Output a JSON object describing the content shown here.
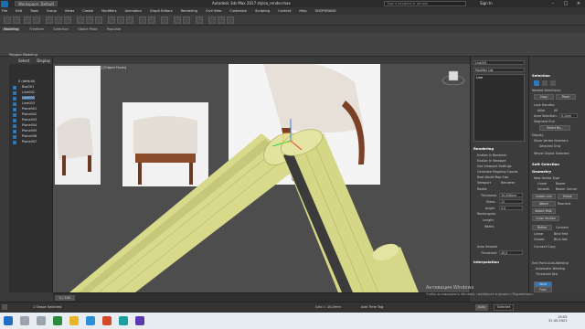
{
  "title_bar": {
    "workspace": "Workspace: Default",
    "app_title": "Autodesk 3ds Max 2017    stylsa_render.max",
    "search_placeholder": "Type a keyword or phrase",
    "sign_in": "Sign In"
  },
  "menu": [
    "File",
    "Edit",
    "Tools",
    "Group",
    "Views",
    "Create",
    "Modifiers",
    "Animation",
    "Graph Editors",
    "Rendering",
    "Civil View",
    "Customize",
    "Scripting",
    "Content",
    "Help",
    "SHOPGRAND"
  ],
  "ribbon": {
    "tabs": [
      "Modeling",
      "Freeform",
      "Selection",
      "Object Paint",
      "Populate"
    ],
    "active_tab": "Modeling",
    "group_label": "Polygon Modeling"
  },
  "explorer": {
    "tabs": [
      "Select",
      "Display"
    ],
    "root": "0 (default)",
    "items": [
      "Box001",
      "Line001",
      "Line002",
      "Line003",
      "Plane001",
      "Plane002",
      "Plane003",
      "Plane004",
      "Plane005",
      "Plane006",
      "Plane007"
    ],
    "selected_index": 2
  },
  "viewport": {
    "label": "[+] [Perspective] [Standard] [Edged Faces]"
  },
  "modify_panel": {
    "object_name": "Line001",
    "modifier_list": "Modifier List",
    "stack_item": "Line",
    "rendering_title": "Rendering",
    "enable_render": "Enable In Renderer",
    "enable_viewport": "Enable In Viewport",
    "use_viewport": "Use Viewport Settings",
    "gen_mapping": "Generate Mapping Coords.",
    "real_world": "Real-World Map Size",
    "viewport_opt": "Viewport",
    "renderer_opt": "Renderer",
    "radial": "Radial",
    "thickness_label": "Thickness:",
    "thickness_val": "30,008mm",
    "sides_label": "Sides:",
    "sides_val": "12",
    "angle_label": "Angle:",
    "angle_val": "0,0",
    "rectangular": "Rectangular",
    "length_label": "Length:",
    "width_label": "Width:",
    "auto_smooth": "Auto Smooth",
    "threshold_label": "Threshold:",
    "threshold_val": "40,0",
    "interpolation_title": "Interpolation"
  },
  "selection_panel": {
    "title": "Selection",
    "named": "Named Selections:",
    "copy": "Copy",
    "paste": "Paste",
    "lock_handles": "Lock Handles",
    "alike": "Alike",
    "all": "All",
    "area_sel": "Area Selection:",
    "area_val": "0,1mm",
    "segment_end": "Segment End",
    "select_by": "Select By...",
    "display": "Display",
    "show_vertex": "Show Vertex Numbers",
    "sel_only": "Selected Only",
    "whole_selected": "Whole Object Selected",
    "soft_title": "Soft Selection",
    "geometry_title": "Geometry",
    "new_vertex": "New Vertex Type",
    "linear": "Linear",
    "bezier": "Bezier",
    "smooth": "Smooth",
    "bezier_corner": "Bezier Corner",
    "create_line": "Create Line",
    "break": "Break",
    "attach": "Attach",
    "reorient": "Reorient",
    "attach_mult": "Attach Mult.",
    "cross_section": "Cross Section",
    "refine": "Refine",
    "connect": "Connect",
    "linear2": "Linear",
    "bind_first": "Bind first",
    "closed": "Closed",
    "bind_last": "Bind last",
    "connect_copy": "Connect Copy",
    "end_point_welding": "End Point Auto-Welding",
    "auto_welding": "Automatic Welding",
    "threshold_dist": "Threshold Dist",
    "weld": "Weld",
    "fuse": "Fuse"
  },
  "status": {
    "selection": "1 Shape Selected",
    "frame": "0 / 100",
    "grid": "Grid = 10,0mm",
    "add_time_tag": "Add Time Tag",
    "auto": "Auto",
    "selected": "Selected"
  },
  "watermark": {
    "line1": "Активация Windows",
    "line2": "Чтобы активировать Windows, перейдите в раздел «Параметры»."
  },
  "taskbar": {
    "time": "15:05",
    "date": "31.05.2021"
  }
}
